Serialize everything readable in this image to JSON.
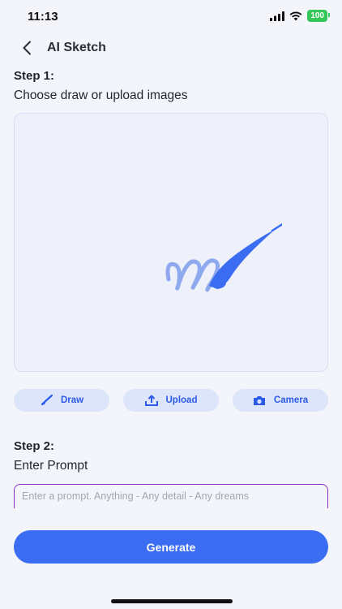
{
  "status": {
    "time": "11:13",
    "battery": "100"
  },
  "nav": {
    "title": "AI Sketch"
  },
  "step1": {
    "title": "Step 1:",
    "subtitle": "Choose draw or upload images"
  },
  "tools": [
    {
      "label": "Draw",
      "icon": "brush-icon"
    },
    {
      "label": "Upload",
      "icon": "upload-icon"
    },
    {
      "label": "Camera",
      "icon": "camera-icon"
    }
  ],
  "step2": {
    "title": "Step 2:",
    "subtitle": "Enter Prompt"
  },
  "prompt": {
    "placeholder": "Enter a prompt. Anything - Any detail - Any dreams",
    "value": ""
  },
  "generate": {
    "label": "Generate"
  },
  "colors": {
    "accent": "#3a6df2",
    "toolBg": "#dde5fb",
    "promptBorder": "#8a2fc0",
    "background": "#f4f5fb"
  }
}
